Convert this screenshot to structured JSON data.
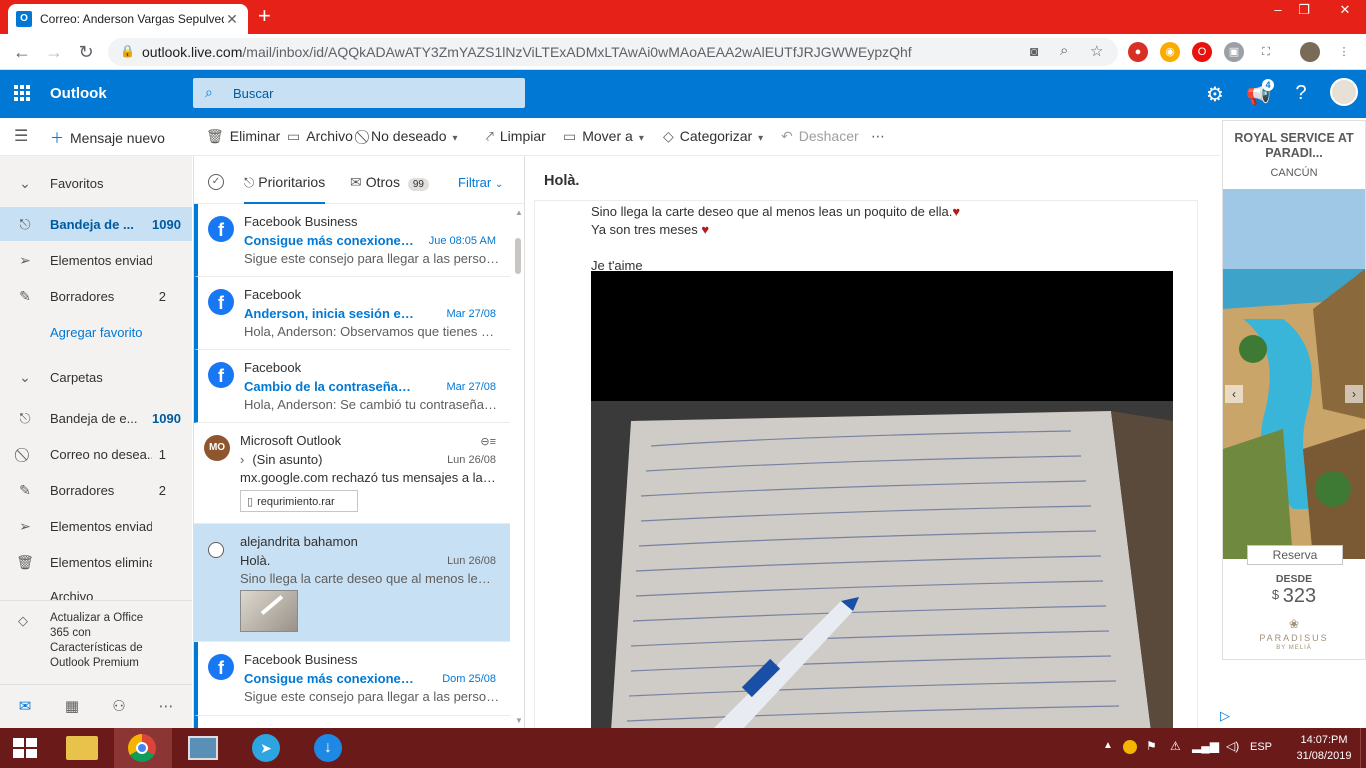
{
  "browser": {
    "tab_title": "Correo: Anderson Vargas Sepulveda - Outlook",
    "url_host": "outlook.live.com",
    "url_path": "/mail/inbox/id/AQQkADAwATY3ZmYAZS1lNzViLTExADMxLTAwAi0wMAoAEAA2wAlEUTfJRJGWWEypzQhf"
  },
  "header": {
    "brand": "Outlook",
    "search_placeholder": "Buscar",
    "notif_count": "4"
  },
  "toolbar": {
    "new_message": "Mensaje nuevo",
    "delete": "Eliminar",
    "archive": "Archivo",
    "junk": "No deseado",
    "sweep": "Limpiar",
    "move": "Mover a",
    "categorize": "Categorizar",
    "undo": "Deshacer"
  },
  "nav": {
    "favorites_title": "Favoritos",
    "favorites": [
      {
        "label": "Bandeja de ...",
        "count": "1090"
      },
      {
        "label": "Elementos enviados",
        "count": ""
      },
      {
        "label": "Borradores",
        "count": "2"
      }
    ],
    "add_favorite": "Agregar favorito",
    "folders_title": "Carpetas",
    "folders": [
      {
        "label": "Bandeja de e...",
        "count": "1090"
      },
      {
        "label": "Correo no desea...",
        "count": "1"
      },
      {
        "label": "Borradores",
        "count": "2"
      },
      {
        "label": "Elementos enviados",
        "count": ""
      },
      {
        "label": "Elementos elimina...",
        "count": ""
      },
      {
        "label": "Archivo",
        "count": ""
      }
    ],
    "upgrade_text": "Actualizar a Office 365 con Características de Outlook Premium"
  },
  "list": {
    "tab_focused": "Prioritarios",
    "tab_other": "Otros",
    "other_count": "99",
    "filter": "Filtrar",
    "messages": [
      {
        "sender": "Facebook Business",
        "subject": "Consigue más conexiones r...",
        "date": "Jue 08:05 AM",
        "preview": "Sigue este consejo para llegar a las persona..."
      },
      {
        "sender": "Facebook",
        "subject": "Anderson, inicia sesión en F...",
        "date": "Mar 27/08",
        "preview": "Hola, Anderson: Observamos que tienes pro..."
      },
      {
        "sender": "Facebook",
        "subject": "Cambio de la contraseña d...",
        "date": "Mar 27/08",
        "preview": "Hola, Anderson: Se cambió tu contraseña d..."
      },
      {
        "sender": "Microsoft Outlook",
        "initials": "MO",
        "subject": "(Sin asunto)",
        "date": "Lun 26/08",
        "preview": "mx.google.com rechazó tus mensajes a las s...",
        "attachment": "requrimiento.rar"
      },
      {
        "sender": "alejandrita bahamon",
        "subject": "Holà.",
        "date": "Lun 26/08",
        "preview": "Sino llega la carte deseo que al menos leas ..."
      },
      {
        "sender": "Facebook Business",
        "subject": "Consigue más conexiones r...",
        "date": "Dom 25/08",
        "preview": "Sigue este consejo para llegar a las persona..."
      }
    ]
  },
  "reading": {
    "subject": "Holà.",
    "line1": "Sino llega la carte deseo que al menos leas un poquito de ella.",
    "line2": "Ya son tres meses",
    "line3": "Je t'aime",
    "heart": "♥"
  },
  "ad": {
    "title": "ROYAL SERVICE AT PARADI...",
    "location": "CANCÚN",
    "cta": "Reserva",
    "from_label": "DESDE",
    "currency": "$",
    "price": "323",
    "brand": "PARADISUS",
    "brand_sub": "BY MELIÁ"
  },
  "taskbar": {
    "lang": "ESP",
    "time": "14:07:PM",
    "date": "31/08/2019"
  },
  "colors": {
    "accent": "#0078d4",
    "chrome_tabbar": "#e62117",
    "taskbar": "#6b1a1a"
  }
}
